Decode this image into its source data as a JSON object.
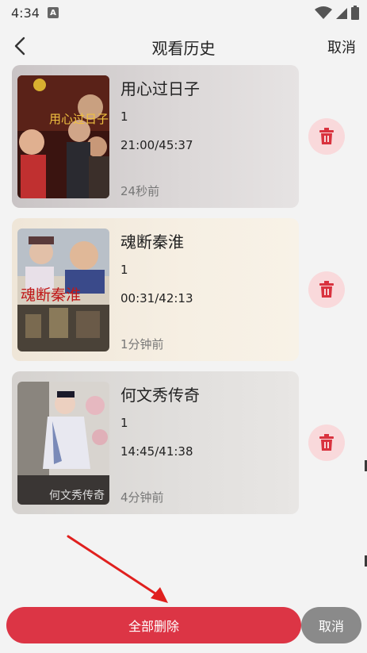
{
  "status_bar": {
    "time": "4:34",
    "notification_letter": "A"
  },
  "header": {
    "title": "观看历史",
    "cancel_label": "取消"
  },
  "history": [
    {
      "title": "用心过日子",
      "episode": "1",
      "progress": "21:00/45:37",
      "time_ago": "24秒前",
      "poster_text": "用心过日子"
    },
    {
      "title": "魂断秦淮",
      "episode": "1",
      "progress": "00:31/42:13",
      "time_ago": "1分钟前",
      "poster_text": "魂断秦淮"
    },
    {
      "title": "何文秀传奇",
      "episode": "1",
      "progress": "14:45/41:38",
      "time_ago": "4分钟前",
      "poster_text": "何文秀传奇"
    }
  ],
  "footer": {
    "delete_all_label": "全部删除",
    "cancel_label": "取消"
  },
  "colors": {
    "accent": "#dc3545",
    "cancel_gray": "#8a8a8a",
    "delete_circle": "#f9d9db"
  },
  "icons": [
    "back-arrow-icon",
    "trash-icon",
    "wifi-icon",
    "signal-icon",
    "battery-icon"
  ]
}
